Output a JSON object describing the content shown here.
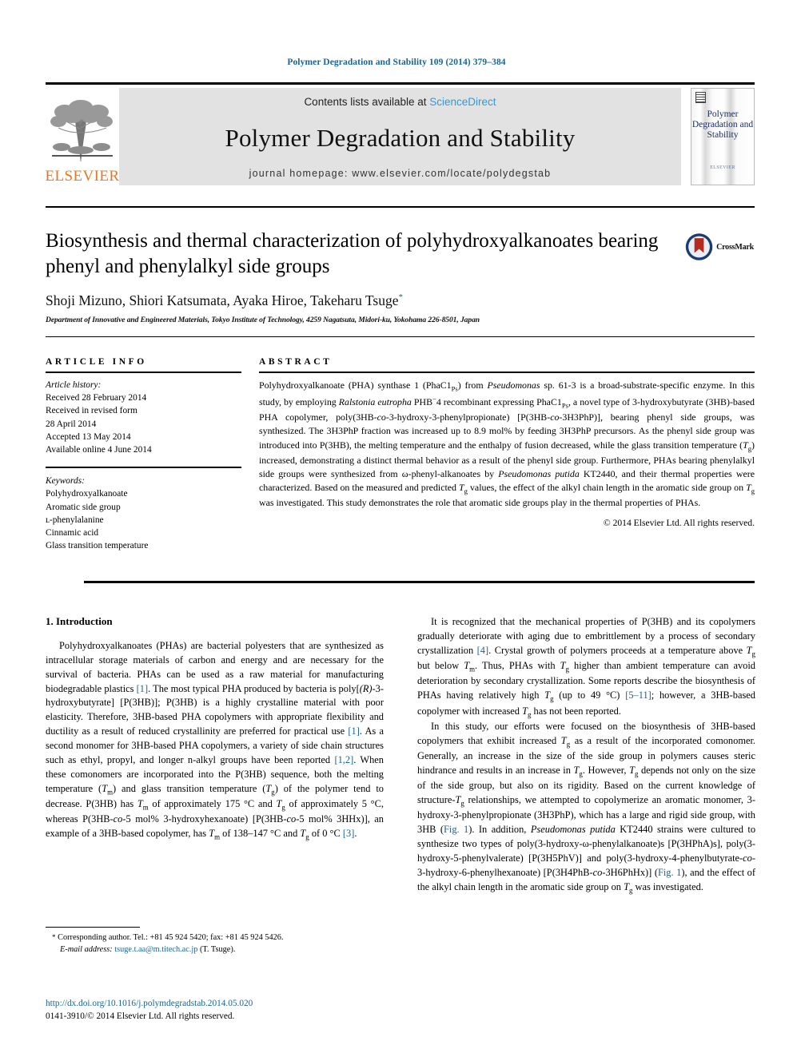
{
  "running_head": "Polymer Degradation and Stability 109 (2014) 379–384",
  "banner": {
    "publisher": "ELSEVIER",
    "contents_prefix": "Contents lists available at ",
    "contents_link": "ScienceDirect",
    "journal_title": "Polymer Degradation and Stability",
    "homepage": "journal homepage: www.elsevier.com/locate/polydegstab",
    "cover_title": "Polymer Degradation and Stability",
    "cover_publisher": "ELSEVIER"
  },
  "article": {
    "title": "Biosynthesis and thermal characterization of polyhydroxyalkanoates bearing phenyl and phenylalkyl side groups",
    "authors": "Shoji Mizuno, Shiori Katsumata, Ayaka Hiroe, Takeharu Tsuge",
    "corresponding_marker": "*",
    "affiliation": "Department of Innovative and Engineered Materials, Tokyo Institute of Technology, 4259 Nagatsuta, Midori-ku, Yokohama 226-8501, Japan",
    "crossmark_label": "CrossMark"
  },
  "article_info": {
    "heading": "ARTICLE INFO",
    "history_label": "Article history:",
    "history": [
      "Received 28 February 2014",
      "Received in revised form",
      "28 April 2014",
      "Accepted 13 May 2014",
      "Available online 4 June 2014"
    ],
    "keywords_label": "Keywords:",
    "keywords": [
      "Polyhydroxyalkanoate",
      "Aromatic side group",
      "ʟ-phenylalanine",
      "Cinnamic acid",
      "Glass transition temperature"
    ]
  },
  "abstract": {
    "heading": "ABSTRACT",
    "text": "Polyhydroxyalkanoate (PHA) synthase 1 (PhaC1Ps) from Pseudomonas sp. 61-3 is a broad-substrate-specific enzyme. In this study, by employing Ralstonia eutropha PHB⁻4 recombinant expressing PhaC1Ps, a novel type of 3-hydroxybutyrate (3HB)-based PHA copolymer, poly(3HB-co-3-hydroxy-3-phenylpropionate) [P(3HB-co-3H3PhP)], bearing phenyl side groups, was synthesized. The 3H3PhP fraction was increased up to 8.9 mol% by feeding 3H3PhP precursors. As the phenyl side group was introduced into P(3HB), the melting temperature and the enthalpy of fusion decreased, while the glass transition temperature (Tg) increased, demonstrating a distinct thermal behavior as a result of the phenyl side group. Furthermore, PHAs bearing phenylalkyl side groups were synthesized from ω-phenyl-alkanoates by Pseudomonas putida KT2440, and their thermal properties were characterized. Based on the measured and predicted Tg values, the effect of the alkyl chain length in the aromatic side group on Tg was investigated. This study demonstrates the role that aromatic side groups play in the thermal properties of PHAs.",
    "copyright": "© 2014 Elsevier Ltd. All rights reserved."
  },
  "introduction": {
    "heading": "1. Introduction",
    "left_paragraph": "Polyhydroxyalkanoates (PHAs) are bacterial polyesters that are synthesized as intracellular storage materials of carbon and energy and are necessary for the survival of bacteria. PHAs can be used as a raw material for manufacturing biodegradable plastics [1]. The most typical PHA produced by bacteria is poly[(R)-3-hydroxybutyrate] [P(3HB)]; P(3HB) is a highly crystalline material with poor elasticity. Therefore, 3HB-based PHA copolymers with appropriate flexibility and ductility as a result of reduced crystallinity are preferred for practical use [1]. As a second monomer for 3HB-based PHA copolymers, a variety of side chain structures such as ethyl, propyl, and longer n-alkyl groups have been reported [1,2]. When these comonomers are incorporated into the P(3HB) sequence, both the melting temperature (Tm) and glass transition temperature (Tg) of the polymer tend to decrease. P(3HB) has Tm of approximately 175 °C and Tg of approximately 5 °C, whereas P(3HB-co-5 mol% 3-hydroxyhexanoate) [P(3HB-co-5 mol% 3HHx)], an example of a 3HB-based copolymer, has Tm of 138–147 °C and Tg of 0 °C [3].",
    "right_paragraph_1": "It is recognized that the mechanical properties of P(3HB) and its copolymers gradually deteriorate with aging due to embrittlement by a process of secondary crystallization [4]. Crystal growth of polymers proceeds at a temperature above Tg but below Tm. Thus, PHAs with Tg higher than ambient temperature can avoid deterioration by secondary crystallization. Some reports describe the biosynthesis of PHAs having relatively high Tg (up to 49 °C) [5–11]; however, a 3HB-based copolymer with increased Tg has not been reported.",
    "right_paragraph_2": "In this study, our efforts were focused on the biosynthesis of 3HB-based copolymers that exhibit increased Tg as a result of the incorporated comonomer. Generally, an increase in the size of the side group in polymers causes steric hindrance and results in an increase in Tg. However, Tg depends not only on the size of the side group, but also on its rigidity. Based on the current knowledge of structure-Tg relationships, we attempted to copolymerize an aromatic monomer, 3-hydroxy-3-phenylpropionate (3H3PhP), which has a large and rigid side group, with 3HB (Fig. 1). In addition, Pseudomonas putida KT2440 strains were cultured to synthesize two types of poly(3-hydroxy-ω-phenylalkanoate)s [P(3HPhA)s], poly(3-hydroxy-5-phenylvalerate) [P(3H5PhV)] and poly(3-hydroxy-4-phenylbutyrate-co-3-hydroxy-6-phenylhexanoate) [P(3H4PhB-co-3H6PhHx)] (Fig. 1), and the effect of the alkyl chain length in the aromatic side group on Tg was investigated."
  },
  "footnote": {
    "star": "*",
    "line1": "Corresponding author. Tel.: +81 45 924 5420; fax: +81 45 924 5426.",
    "email_label": "E-mail address:",
    "email": "tsuge.t.aa@m.titech.ac.jp",
    "email_suffix": "(T. Tsuge)."
  },
  "footer": {
    "doi": "http://dx.doi.org/10.1016/j.polymdegradstab.2014.05.020",
    "issn_line": "0141-3910/© 2014 Elsevier Ltd. All rights reserved."
  },
  "colors": {
    "link": "#1a6496",
    "sciencedirect": "#2f9bd6",
    "elsevier_orange": "#E87722",
    "cover_blue": "#1b2f66",
    "banner_grey": "#e2e2e2"
  }
}
